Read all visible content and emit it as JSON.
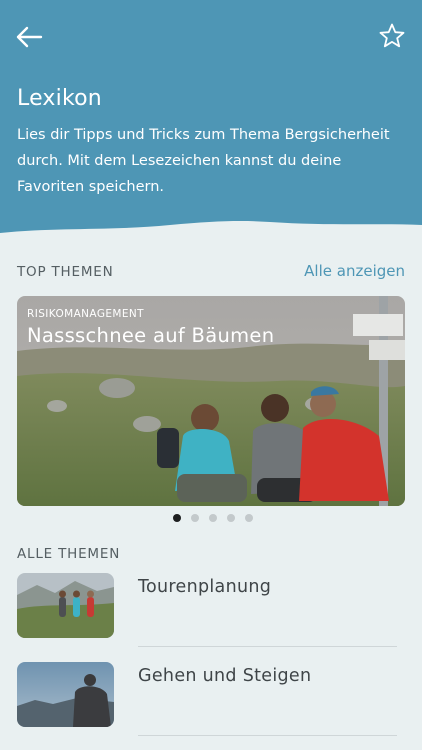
{
  "header": {
    "back_icon": "arrow-left-icon",
    "bookmark_icon": "star-icon",
    "title": "Lexikon",
    "description": "Lies dir Tipps und Tricks zum Thema Bergsicherheit durch. Mit dem Lesezeichen kannst du deine Favoriten speichern."
  },
  "top_topics": {
    "label": "TOP THEMEN",
    "show_all": "Alle anzeigen",
    "card": {
      "category": "RISIKOMANAGEMENT",
      "title": "Nassschnee auf Bäumen"
    },
    "pagination": {
      "total": 5,
      "active": 1
    }
  },
  "all_topics": {
    "label": "ALLE THEMEN",
    "items": [
      {
        "title": "Tourenplanung"
      },
      {
        "title": "Gehen und Steigen"
      }
    ]
  },
  "colors": {
    "header": "#4e96b5",
    "background": "#e9f0f1",
    "accent": "#4e96b5"
  }
}
